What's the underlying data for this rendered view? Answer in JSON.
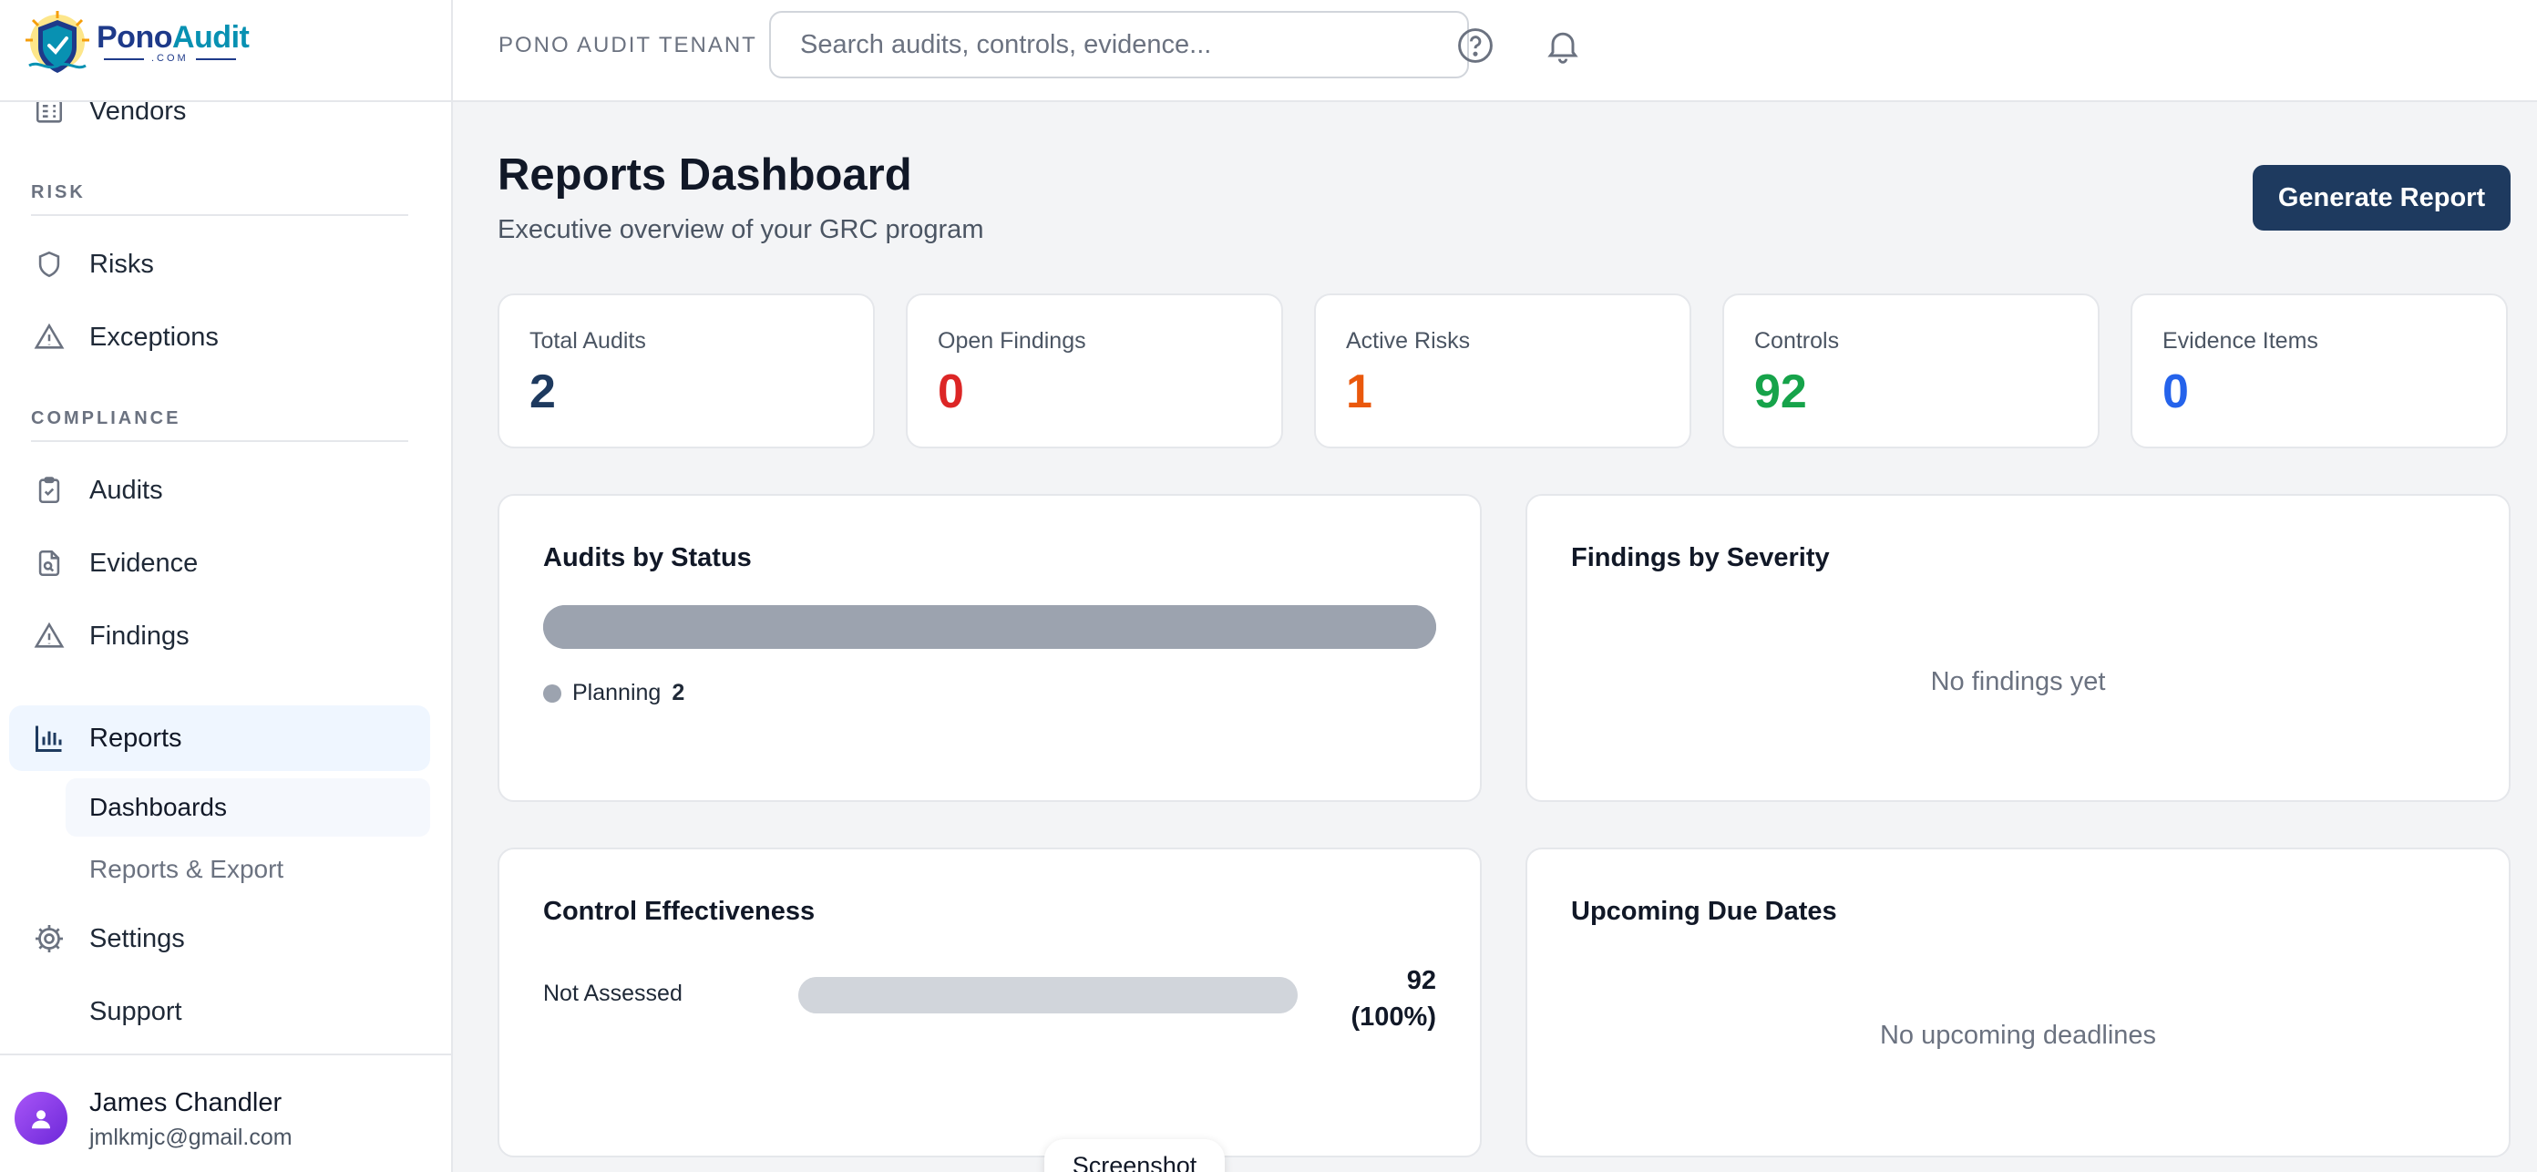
{
  "brand": {
    "name_part1": "Pono",
    "name_part2": "Audit",
    "domain": ".COM"
  },
  "sidebar": {
    "top_item": {
      "label": "Vendors",
      "icon": "building-icon"
    },
    "sections": [
      {
        "label": "RISK",
        "items": [
          {
            "label": "Risks",
            "icon": "shield-icon"
          },
          {
            "label": "Exceptions",
            "icon": "warning-triangle-icon"
          }
        ]
      },
      {
        "label": "COMPLIANCE",
        "items": [
          {
            "label": "Audits",
            "icon": "clipboard-check-icon"
          },
          {
            "label": "Evidence",
            "icon": "file-search-icon"
          },
          {
            "label": "Findings",
            "icon": "warning-triangle-icon"
          }
        ]
      }
    ],
    "reports": {
      "label": "Reports",
      "icon": "bar-chart-icon",
      "active": true,
      "children": [
        {
          "label": "Dashboards",
          "active": true
        },
        {
          "label": "Reports & Export",
          "active": false
        }
      ]
    },
    "settings": {
      "label": "Settings",
      "icon": "gear-icon"
    },
    "support": {
      "label": "Support"
    }
  },
  "user": {
    "name": "James Chandler",
    "email": "jmlkmjc@gmail.com"
  },
  "header": {
    "tenant": "PONO AUDIT TENANT",
    "search_placeholder": "Search audits, controls, evidence...",
    "icons": [
      "help-icon",
      "bell-icon"
    ]
  },
  "page": {
    "title": "Reports Dashboard",
    "subtitle": "Executive overview of your GRC program",
    "action_label": "Generate Report"
  },
  "stats": [
    {
      "label": "Total Audits",
      "value": "2",
      "color": "#1e3a5f"
    },
    {
      "label": "Open Findings",
      "value": "0",
      "color": "#dc2626"
    },
    {
      "label": "Active Risks",
      "value": "1",
      "color": "#ea580c"
    },
    {
      "label": "Controls",
      "value": "92",
      "color": "#16a34a"
    },
    {
      "label": "Evidence Items",
      "value": "0",
      "color": "#2563eb"
    }
  ],
  "panels": {
    "audits_by_status": {
      "title": "Audits by Status",
      "segments": [
        {
          "label": "Planning",
          "count": "2",
          "fraction": 1.0,
          "color": "#9ca3af"
        }
      ]
    },
    "findings_by_severity": {
      "title": "Findings by Severity",
      "empty": "No findings yet"
    },
    "control_effectiveness": {
      "title": "Control Effectiveness",
      "rows": [
        {
          "label": "Not Assessed",
          "value": "92 (100%)",
          "fraction": 1.0
        }
      ]
    },
    "upcoming_due_dates": {
      "title": "Upcoming Due Dates",
      "empty": "No upcoming deadlines"
    }
  },
  "toast": {
    "label": "Screenshot"
  }
}
